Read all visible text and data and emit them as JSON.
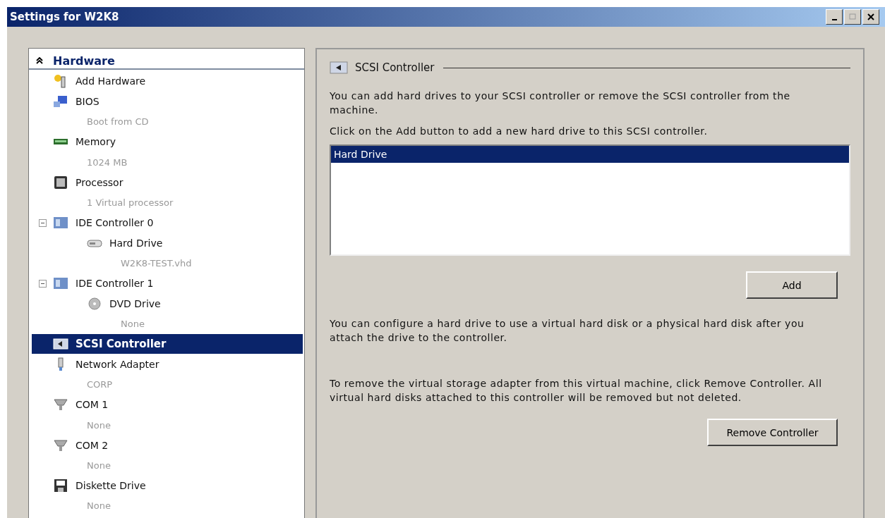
{
  "window": {
    "title": "Settings for W2K8"
  },
  "sidebar": {
    "header": {
      "label": "Hardware",
      "expanded": true
    },
    "items": [
      {
        "label": "Add Hardware",
        "kind": "add",
        "selected": false
      },
      {
        "label": "BIOS",
        "detail": "Boot from CD",
        "kind": "bios",
        "selected": false
      },
      {
        "label": "Memory",
        "detail": "1024 MB",
        "kind": "memory",
        "selected": false
      },
      {
        "label": "Processor",
        "detail": "1 Virtual processor",
        "kind": "processor",
        "selected": false
      },
      {
        "label": "IDE Controller 0",
        "kind": "ide",
        "selected": false,
        "expanded": true,
        "children": [
          {
            "label": "Hard Drive",
            "detail": "W2K8-TEST.vhd",
            "kind": "disk",
            "selected": false
          }
        ]
      },
      {
        "label": "IDE Controller 1",
        "kind": "ide",
        "selected": false,
        "expanded": true,
        "children": [
          {
            "label": "DVD Drive",
            "detail": "None",
            "kind": "dvd",
            "selected": false
          }
        ]
      },
      {
        "label": "SCSI Controller",
        "kind": "scsi",
        "selected": true
      },
      {
        "label": "Network Adapter",
        "detail": "CORP",
        "kind": "network",
        "selected": false
      },
      {
        "label": "COM 1",
        "detail": "None",
        "kind": "com",
        "selected": false
      },
      {
        "label": "COM 2",
        "detail": "None",
        "kind": "com",
        "selected": false
      },
      {
        "label": "Diskette Drive",
        "detail": "None",
        "kind": "diskette",
        "selected": false
      }
    ]
  },
  "panel": {
    "title": "SCSI Controller",
    "intro": "You can add hard drives to your SCSI controller or remove the SCSI controller from the machine.",
    "instruction": "Click on the Add button to add a new hard drive to this SCSI controller.",
    "list": [
      {
        "label": "Hard Drive",
        "selected": true
      }
    ],
    "add_button": "Add",
    "configure_note": "You can configure a hard drive to use a virtual hard disk or a physical hard disk after you attach the drive to the controller.",
    "remove_note": "To remove the virtual storage adapter from this virtual machine, click Remove Controller. All virtual hard disks attached to this controller will be removed but not deleted.",
    "remove_button": "Remove Controller"
  }
}
